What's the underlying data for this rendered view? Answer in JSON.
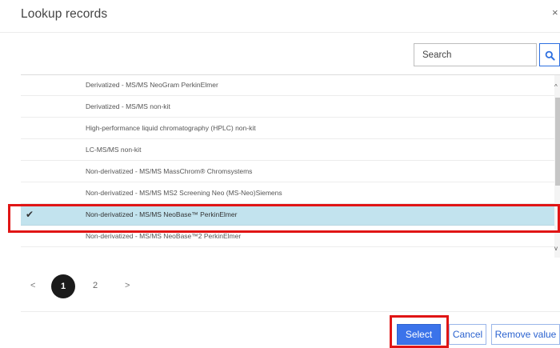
{
  "dialog": {
    "title": "Lookup records",
    "close_glyph": "×"
  },
  "search": {
    "placeholder": "Search",
    "button_icon": "search-icon"
  },
  "records": [
    {
      "label": "Derivatized - MS/MS NeoGram PerkinElmer",
      "selected": false
    },
    {
      "label": "Derivatized - MS/MS non-kit",
      "selected": false
    },
    {
      "label": "High-performance liquid chromatography (HPLC) non-kit",
      "selected": false
    },
    {
      "label": "LC-MS/MS non-kit",
      "selected": false
    },
    {
      "label": "Non-derivatized - MS/MS MassChrom® Chromsystems",
      "selected": false
    },
    {
      "label": "Non-derivatized - MS/MS MS2 Screening Neo (MS-Neo)Siemens",
      "selected": false
    },
    {
      "label": "Non-derivatized - MS/MS NeoBase™ PerkinElmer",
      "selected": true
    },
    {
      "label": "Non-derivatized - MS/MS NeoBase™2 PerkinElmer",
      "selected": false
    }
  ],
  "selected_check_glyph": "✔",
  "scrollbar": {
    "up_glyph": "^",
    "down_glyph": "v"
  },
  "pagination": {
    "prev_glyph": "<",
    "current_page": "1",
    "page_2": "2",
    "next_glyph": ">"
  },
  "footer": {
    "select_label": "Select",
    "cancel_label": "Cancel",
    "remove_label": "Remove value"
  },
  "colors": {
    "accent": "#3b73ea",
    "selected_row": "#c2e3ee",
    "highlight_box": "#e01515"
  }
}
